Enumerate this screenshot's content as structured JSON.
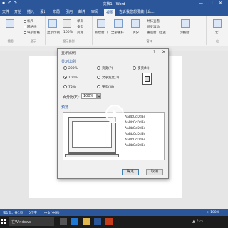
{
  "window": {
    "title": "文档1 - Word",
    "controls": [
      "—",
      "❐",
      "✕"
    ]
  },
  "tabs": [
    "文件",
    "开始",
    "插入",
    "设计",
    "布局",
    "引用",
    "邮件",
    "审阅",
    "视图"
  ],
  "tell_me": "告诉我您想要做什么...",
  "ribbon": {
    "groups": [
      "视图",
      "显示",
      "显示比例",
      "窗口",
      "宏"
    ],
    "show_items": [
      "标尺",
      "网格线",
      "导航窗格"
    ],
    "zoom_items": [
      "显示比例",
      "100%",
      "单页",
      "多页",
      "页宽"
    ],
    "window_items": [
      "新建窗口",
      "全部重排",
      "拆分",
      "并排查看",
      "同步滚动",
      "重设窗口位置",
      "切换窗口"
    ],
    "macro_label": "宏"
  },
  "dialog": {
    "title": "显示比例",
    "help": "?",
    "close": "✕",
    "zoom_section": "显示比例",
    "radios": [
      {
        "label": "200%",
        "selected": false
      },
      {
        "label": "100%",
        "selected": true
      },
      {
        "label": "75%",
        "selected": false
      },
      {
        "label": "页宽(P)",
        "selected": false
      },
      {
        "label": "文字宽度(T)",
        "selected": false
      },
      {
        "label": "整页(W)",
        "selected": false
      },
      {
        "label": "多页(M):",
        "selected": false
      }
    ],
    "percent_label": "百分比(E):",
    "percent_value": "100%",
    "preview_section": "预览",
    "sample_text": "AaBbCcDdEe",
    "sample_lines": 6,
    "ok": "确定",
    "cancel": "取消"
  },
  "statusbar": {
    "page": "第1页，共1页",
    "words": "0个字",
    "language": "中文(中国)",
    "zoom": "+ 100%"
  },
  "taskbar": {
    "search_placeholder": "在Windows"
  },
  "colors": {
    "accent": "#2b579a",
    "dialog_bg": "#f0f0f0",
    "taskbar": "#1c1c1c"
  }
}
